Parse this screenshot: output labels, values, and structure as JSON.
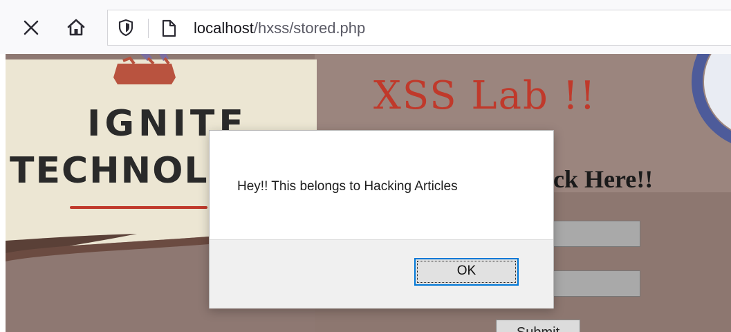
{
  "browser": {
    "close_icon": "close-icon",
    "home_icon": "home-icon",
    "shield_icon": "shield-icon",
    "page_icon": "page-icon",
    "url_host": "localhost",
    "url_path": "/hxss/stored.php"
  },
  "page": {
    "logo_line1": "IGNITE",
    "logo_line2": "TECHNOLOG",
    "title": "XSS Lab !!",
    "click_here": "ck Here!!",
    "submit_label": "Submit",
    "title_color": "#c0392b"
  },
  "alert": {
    "message": "Hey!! This belongs to Hacking Articles",
    "ok_label": "OK"
  }
}
